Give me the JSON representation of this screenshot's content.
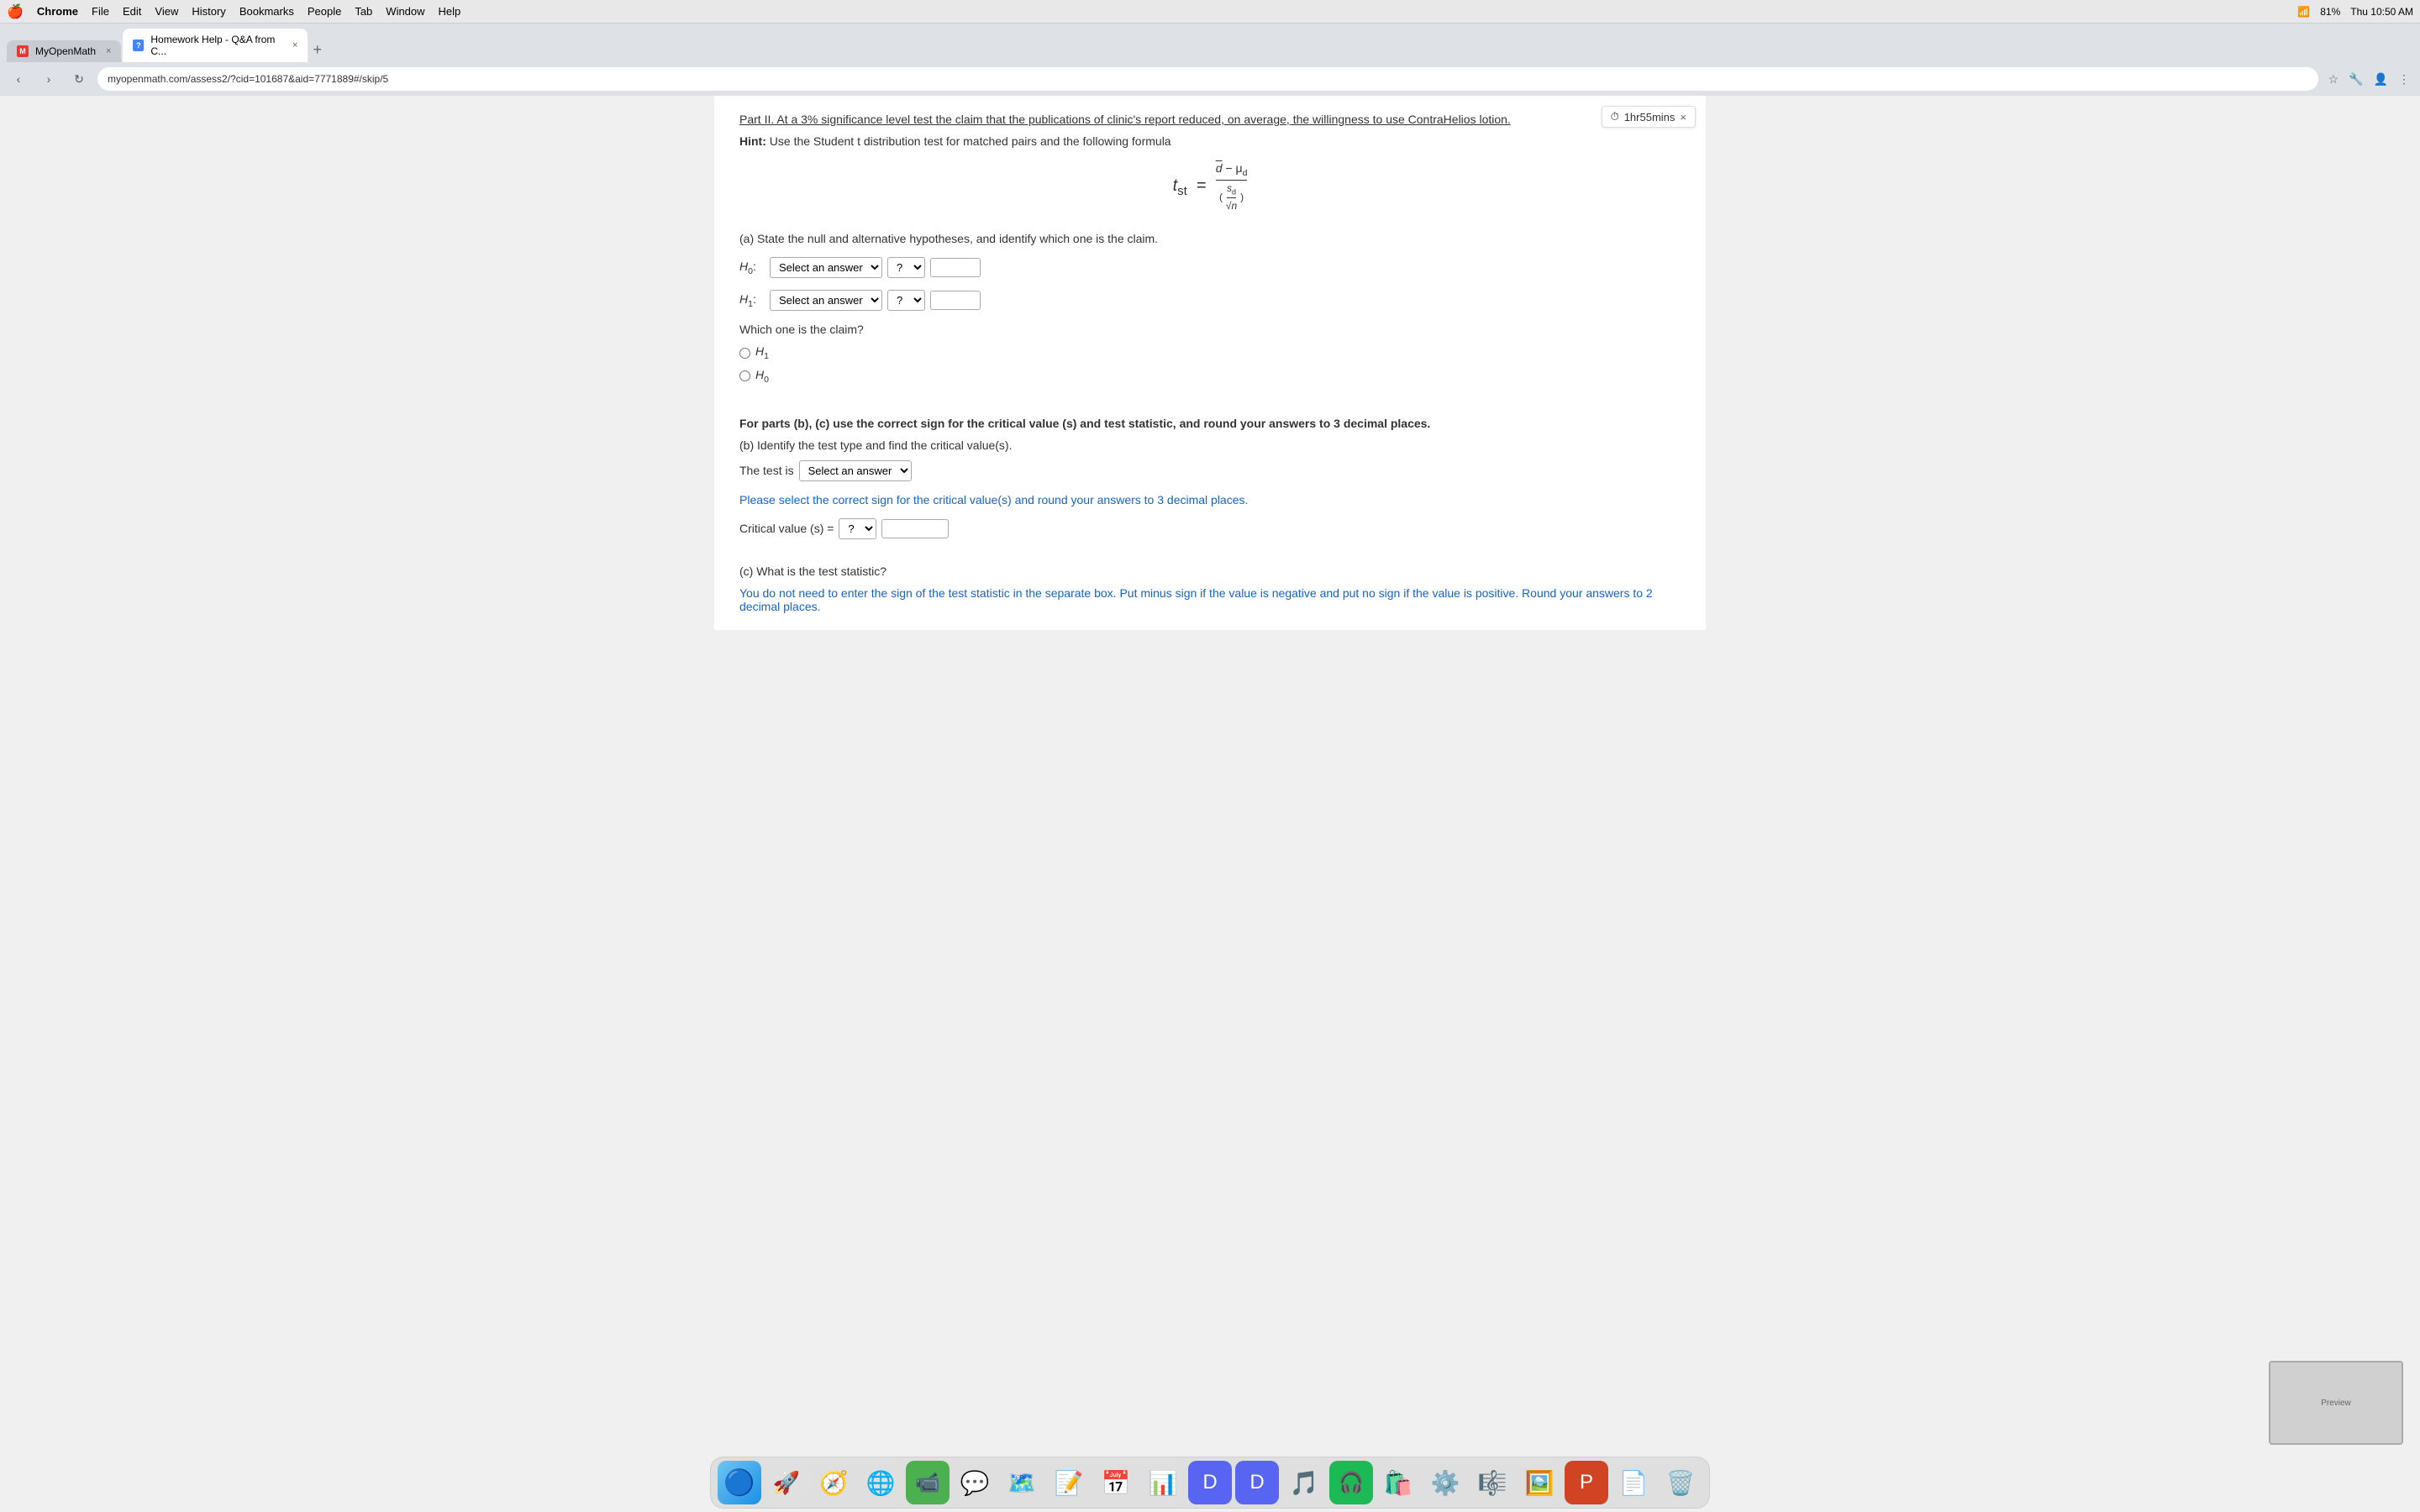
{
  "menubar": {
    "apple": "🍎",
    "items": [
      "Chrome",
      "File",
      "Edit",
      "View",
      "History",
      "Bookmarks",
      "People",
      "Tab",
      "Window",
      "Help"
    ],
    "right": {
      "battery": "81%",
      "time": "Thu 10:50 AM"
    }
  },
  "browser": {
    "tabs": [
      {
        "id": "tab1",
        "label": "MyOpenMath",
        "active": false,
        "favicon_text": "M"
      },
      {
        "id": "tab2",
        "label": "Homework Help - Q&A from C...",
        "active": true,
        "favicon_text": "?"
      }
    ],
    "address": "myopenmath.com/assess2/?cid=101687&aid=7771889#/skip/5"
  },
  "timer": {
    "icon": "⏱",
    "label": "1hr55mins",
    "close": "×"
  },
  "content": {
    "part_label": "Part II.",
    "part_text": " At a 3% significance level test the claim that the publications of clinic's report reduced, on average, the willingness to use ContraHelios lotion.",
    "hint_label": "Hint:",
    "hint_text": "  Use the Student t distribution test for matched pairs and the following formula",
    "formula": "t_st = (d̄ − μ_d) / (s_d / √n)",
    "question_a": "(a) State the null and alternative hypotheses, and identify which one is the claim.",
    "h0_label": "H₀:",
    "h1_label": "H₁:",
    "select_placeholder": "Select an answer",
    "question_mark": "?",
    "which_claim": "Which one is the claim?",
    "radio_h1": "H₁",
    "radio_h0": "H₀",
    "bold_instruction": "For parts (b), (c) use the correct sign for the critical value (s) and test statistic, and round your answers to 3 decimal places.",
    "question_b": "(b) Identify the test type and find the critical value(s).",
    "test_is": "The test is",
    "blue_note": "Please select the correct sign for the critical value(s) and round your answers to 3 decimal places.",
    "critical_label": "Critical value (s) =",
    "question_c": "(c) What is the test statistic?",
    "blue_note_c": "You do not need to enter the sign of the test statistic in the separate box. Put minus sign if the value is negative and put no sign if the value is positive. Round your answers to 2 decimal places."
  },
  "dropdowns": {
    "select_answer_h0": "Select an answer",
    "select_answer_h1": "Select an answer",
    "question_mark_h0": "?",
    "question_mark_h1": "?",
    "test_type": "Select an answer",
    "critical_sign": "?"
  }
}
